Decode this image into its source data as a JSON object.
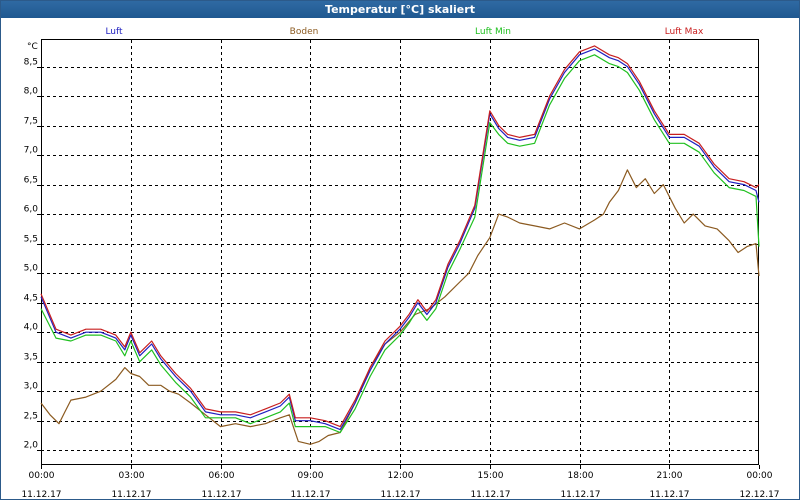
{
  "window": {
    "title": "Temperatur [°C] skaliert"
  },
  "chart_data": {
    "type": "line",
    "title": "Temperatur [°C] skaliert",
    "y_unit": "°C",
    "ylim": [
      1.75,
      8.95
    ],
    "y_ticks": [
      "2,0",
      "2,5",
      "3,0",
      "3,5",
      "4,0",
      "4,5",
      "5,0",
      "5,5",
      "6,0",
      "6,5",
      "7,0",
      "7,5",
      "8,0",
      "8,5"
    ],
    "y_tick_values": [
      2.0,
      2.5,
      3.0,
      3.5,
      4.0,
      4.5,
      5.0,
      5.5,
      6.0,
      6.5,
      7.0,
      7.5,
      8.0,
      8.5
    ],
    "x_ticks": [
      {
        "time": "00:00",
        "date": "11.12.17"
      },
      {
        "time": "03:00",
        "date": "11.12.17"
      },
      {
        "time": "06:00",
        "date": "11.12.17"
      },
      {
        "time": "09:00",
        "date": "11.12.17"
      },
      {
        "time": "12:00",
        "date": "11.12.17"
      },
      {
        "time": "15:00",
        "date": "11.12.17"
      },
      {
        "time": "18:00",
        "date": "11.12.17"
      },
      {
        "time": "21:00",
        "date": "11.12.17"
      },
      {
        "time": "00:00",
        "date": "12.12.17"
      }
    ],
    "x_tick_hours": [
      0,
      3,
      6,
      9,
      12,
      15,
      18,
      21,
      24
    ],
    "grid": true,
    "legend_position": "top",
    "series": [
      {
        "name": "Luft",
        "color": "#2020c0",
        "x": [
          0,
          0.5,
          1,
          1.5,
          2,
          2.5,
          2.8,
          3,
          3.3,
          3.5,
          3.7,
          4,
          4.5,
          5,
          5.5,
          6,
          6.5,
          7,
          7.5,
          8,
          8.3,
          8.5,
          9,
          9.5,
          10,
          10.5,
          11,
          11.5,
          12,
          12.3,
          12.6,
          12.9,
          13.2,
          13.6,
          14,
          14.5,
          15,
          15.3,
          15.6,
          16,
          16.5,
          17,
          17.5,
          18,
          18.5,
          19,
          19.3,
          19.6,
          20,
          20.5,
          21,
          21.5,
          22,
          22.5,
          23,
          23.5,
          23.9,
          24
        ],
        "y": [
          4.6,
          4.0,
          3.9,
          4.0,
          4.0,
          3.9,
          3.7,
          3.95,
          3.6,
          3.7,
          3.8,
          3.55,
          3.25,
          3.0,
          2.65,
          2.6,
          2.6,
          2.55,
          2.65,
          2.75,
          2.9,
          2.5,
          2.5,
          2.45,
          2.35,
          2.8,
          3.35,
          3.8,
          4.05,
          4.25,
          4.5,
          4.3,
          4.5,
          5.1,
          5.5,
          6.1,
          7.7,
          7.45,
          7.3,
          7.25,
          7.3,
          7.95,
          8.4,
          8.7,
          8.8,
          8.65,
          8.6,
          8.5,
          8.2,
          7.7,
          7.3,
          7.3,
          7.15,
          6.8,
          6.55,
          6.5,
          6.4,
          6.2
        ]
      },
      {
        "name": "Boden",
        "color": "#8b5a20",
        "x": [
          0,
          0.3,
          0.6,
          0.8,
          1,
          1.5,
          2,
          2.5,
          2.8,
          3,
          3.3,
          3.6,
          4,
          4.3,
          4.6,
          5,
          5.5,
          6,
          6.5,
          7,
          7.5,
          8,
          8.3,
          8.6,
          9,
          9.3,
          9.6,
          10,
          10.5,
          11,
          11.5,
          12,
          12.5,
          13,
          13.5,
          14,
          14.3,
          14.6,
          15,
          15.3,
          15.6,
          16,
          16.5,
          17,
          17.5,
          18,
          18.5,
          18.8,
          19,
          19.3,
          19.6,
          19.9,
          20.2,
          20.5,
          20.8,
          21.2,
          21.5,
          21.8,
          22.2,
          22.6,
          23,
          23.3,
          23.6,
          23.9,
          24
        ],
        "y": [
          2.8,
          2.6,
          2.45,
          2.65,
          2.85,
          2.9,
          3.0,
          3.2,
          3.4,
          3.3,
          3.25,
          3.1,
          3.1,
          3.0,
          2.95,
          2.8,
          2.6,
          2.4,
          2.45,
          2.4,
          2.45,
          2.55,
          2.6,
          2.15,
          2.1,
          2.15,
          2.25,
          2.3,
          2.8,
          3.4,
          3.8,
          4.0,
          4.3,
          4.4,
          4.6,
          4.85,
          5.0,
          5.3,
          5.6,
          6.0,
          5.95,
          5.85,
          5.8,
          5.75,
          5.85,
          5.75,
          5.9,
          6.0,
          6.2,
          6.4,
          6.75,
          6.45,
          6.6,
          6.35,
          6.5,
          6.1,
          5.85,
          6.0,
          5.8,
          5.75,
          5.55,
          5.35,
          5.45,
          5.5,
          4.95
        ]
      },
      {
        "name": "Luft Min",
        "color": "#20c020",
        "x": [
          0,
          0.5,
          1,
          1.5,
          2,
          2.5,
          2.8,
          3,
          3.3,
          3.5,
          3.7,
          4,
          4.5,
          5,
          5.5,
          6,
          6.5,
          7,
          7.5,
          8,
          8.3,
          8.5,
          9,
          9.5,
          10,
          10.5,
          11,
          11.5,
          12,
          12.3,
          12.6,
          12.9,
          13.2,
          13.6,
          14,
          14.5,
          15,
          15.3,
          15.6,
          16,
          16.5,
          17,
          17.5,
          18,
          18.5,
          19,
          19.3,
          19.6,
          20,
          20.5,
          21,
          21.5,
          22,
          22.5,
          23,
          23.5,
          23.9,
          24
        ],
        "y": [
          4.4,
          3.9,
          3.85,
          3.95,
          3.95,
          3.85,
          3.6,
          3.85,
          3.5,
          3.6,
          3.7,
          3.45,
          3.15,
          2.9,
          2.55,
          2.55,
          2.55,
          2.45,
          2.55,
          2.65,
          2.8,
          2.4,
          2.4,
          2.4,
          2.3,
          2.7,
          3.25,
          3.7,
          3.95,
          4.15,
          4.4,
          4.2,
          4.4,
          5.0,
          5.4,
          5.95,
          7.55,
          7.35,
          7.2,
          7.15,
          7.2,
          7.85,
          8.3,
          8.6,
          8.7,
          8.55,
          8.5,
          8.4,
          8.1,
          7.6,
          7.2,
          7.2,
          7.05,
          6.7,
          6.45,
          6.4,
          6.3,
          5.45
        ]
      },
      {
        "name": "Luft Max",
        "color": "#c81e1e",
        "x": [
          0,
          0.5,
          1,
          1.5,
          2,
          2.5,
          2.8,
          3,
          3.3,
          3.5,
          3.7,
          4,
          4.5,
          5,
          5.5,
          6,
          6.5,
          7,
          7.5,
          8,
          8.3,
          8.5,
          9,
          9.5,
          10,
          10.5,
          11,
          11.5,
          12,
          12.3,
          12.6,
          12.9,
          13.2,
          13.6,
          14,
          14.5,
          15,
          15.3,
          15.6,
          16,
          16.5,
          17,
          17.5,
          18,
          18.5,
          19,
          19.3,
          19.6,
          20,
          20.5,
          21,
          21.5,
          22,
          22.5,
          23,
          23.5,
          23.9,
          24
        ],
        "y": [
          4.65,
          4.05,
          3.95,
          4.05,
          4.05,
          3.95,
          3.75,
          4.0,
          3.65,
          3.75,
          3.85,
          3.6,
          3.3,
          3.05,
          2.7,
          2.65,
          2.65,
          2.6,
          2.7,
          2.8,
          2.95,
          2.55,
          2.55,
          2.5,
          2.4,
          2.85,
          3.4,
          3.85,
          4.1,
          4.3,
          4.55,
          4.35,
          4.55,
          5.15,
          5.55,
          6.15,
          7.75,
          7.5,
          7.35,
          7.3,
          7.35,
          8.0,
          8.45,
          8.75,
          8.85,
          8.7,
          8.65,
          8.55,
          8.25,
          7.75,
          7.35,
          7.35,
          7.2,
          6.85,
          6.6,
          6.55,
          6.45,
          6.5
        ]
      }
    ]
  }
}
